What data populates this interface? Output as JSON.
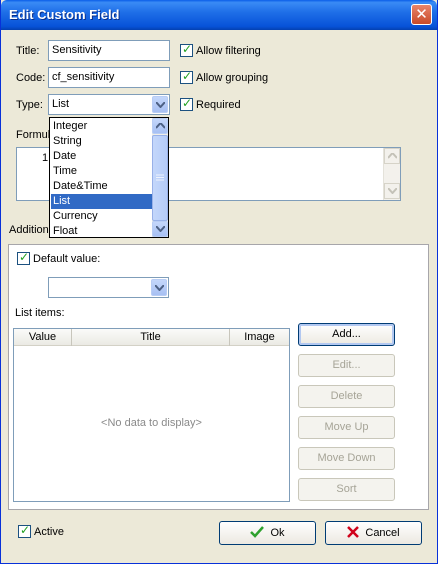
{
  "window": {
    "title": "Edit Custom Field"
  },
  "fields": {
    "title_label": "Title:",
    "title_value": "Sensitivity",
    "code_label": "Code:",
    "code_value": "cf_sensitivity",
    "type_label": "Type:",
    "type_value": "List",
    "formula_label": "Formula",
    "formula_line_number": "1",
    "additional_label": "Addition"
  },
  "options": {
    "allow_filtering": {
      "label": "Allow filtering",
      "checked": true
    },
    "allow_grouping": {
      "label": "Allow grouping",
      "checked": true
    },
    "required": {
      "label": "Required",
      "checked": true
    }
  },
  "type_dropdown": {
    "items": [
      "Integer",
      "String",
      "Date",
      "Time",
      "Date&Time",
      "List",
      "Currency",
      "Float"
    ],
    "selected": "List"
  },
  "panel": {
    "default_value_label": "Default value:",
    "default_value_checked": true,
    "default_value_selected": "",
    "list_items_label": "List items:",
    "columns": [
      "Value",
      "Title",
      "Image"
    ],
    "empty_text": "<No data to display>",
    "buttons": {
      "add": "Add...",
      "edit": "Edit...",
      "delete": "Delete",
      "move_up": "Move Up",
      "move_down": "Move Down",
      "sort": "Sort"
    }
  },
  "footer": {
    "active_label": "Active",
    "active_checked": true,
    "ok": "Ok",
    "cancel": "Cancel"
  },
  "colors": {
    "title_bar": "#0752d8",
    "dialog_bg": "#ece9d8",
    "selection": "#316ac5",
    "check_green": "#21a121",
    "cancel_red": "#d0021b"
  }
}
